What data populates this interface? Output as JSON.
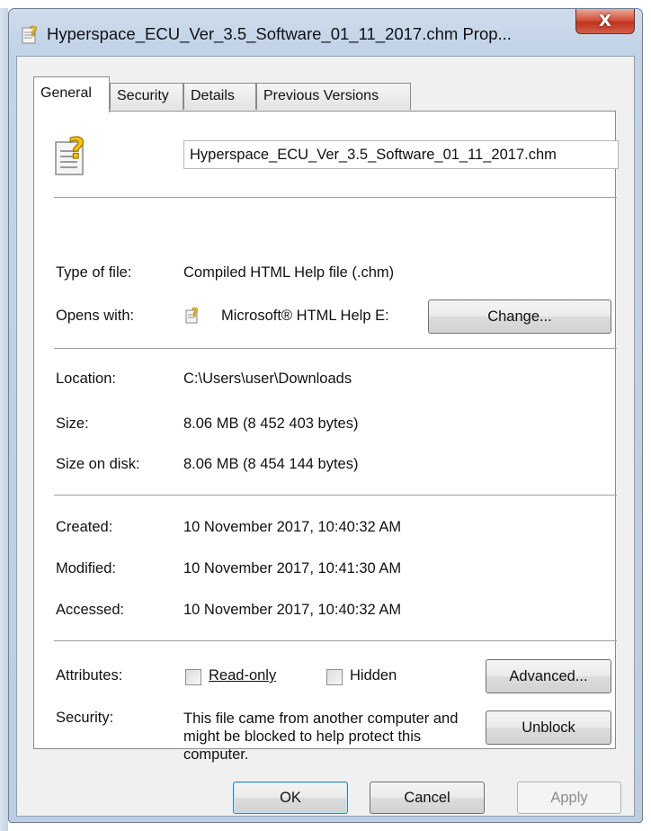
{
  "window": {
    "title": "Hyperspace_ECU_Ver_3.5_Software_01_11_2017.chm Prop...",
    "close_glyph": "X"
  },
  "tabs": [
    {
      "label": "General",
      "active": true
    },
    {
      "label": "Security",
      "active": false
    },
    {
      "label": "Details",
      "active": false
    },
    {
      "label": "Previous Versions",
      "active": false
    }
  ],
  "general": {
    "file_name": "Hyperspace_ECU_Ver_3.5_Software_01_11_2017.chm",
    "type_label": "Type of file:",
    "type_value": "Compiled HTML Help file (.chm)",
    "opens_label": "Opens with:",
    "opens_value": "Microsoft® HTML Help E:",
    "change_button": "Change...",
    "location_label": "Location:",
    "location_value": "C:\\Users\\user\\Downloads",
    "size_label": "Size:",
    "size_value": "8.06 MB (8 452 403 bytes)",
    "size_on_disk_label": "Size on disk:",
    "size_on_disk_value": "8.06 MB (8 454 144 bytes)",
    "created_label": "Created:",
    "created_value": "10 November 2017, 10:40:32 AM",
    "modified_label": "Modified:",
    "modified_value": "10 November 2017, 10:41:30 AM",
    "accessed_label": "Accessed:",
    "accessed_value": "10 November 2017, 10:40:32 AM",
    "attributes_label": "Attributes:",
    "readonly_label": "Read-only",
    "readonly_checked": false,
    "hidden_label": "Hidden",
    "hidden_checked": false,
    "advanced_button": "Advanced...",
    "security_label": "Security:",
    "security_text": "This file came from another computer and might be blocked to help protect this computer.",
    "unblock_button": "Unblock"
  },
  "footer": {
    "ok": "OK",
    "cancel": "Cancel",
    "apply": "Apply"
  },
  "icons": {
    "file": "help-file-icon",
    "app": "html-help-icon",
    "close": "close-icon"
  },
  "colors": {
    "close_button": "#c2331c",
    "frame": "#c3d4e8",
    "client": "#f0f0f0",
    "panel": "#ffffff",
    "disabled_text": "#8d8d8d"
  }
}
